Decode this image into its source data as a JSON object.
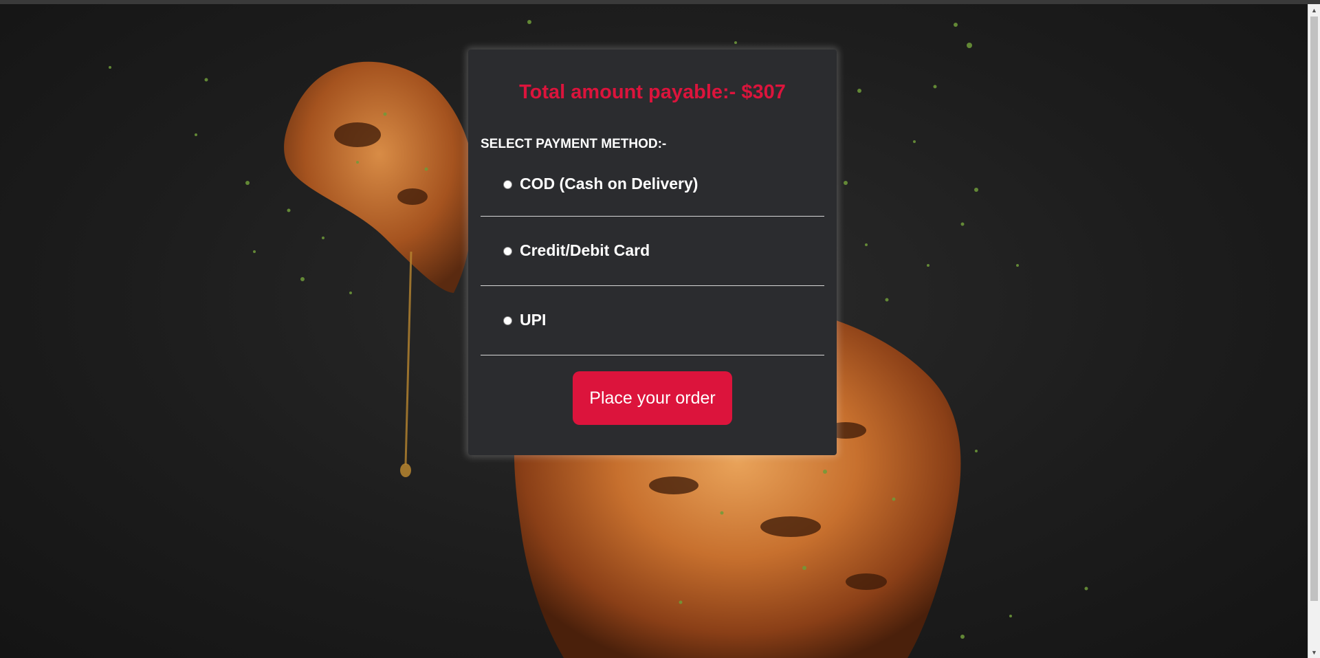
{
  "checkout": {
    "total_label": "Total amount payable:- $307",
    "payment_heading": "SELECT PAYMENT METHOD:-",
    "payment_options": [
      {
        "label": "COD (Cash on Delivery)",
        "selected": false
      },
      {
        "label": "Credit/Debit Card",
        "selected": false
      },
      {
        "label": "UPI",
        "selected": false
      }
    ],
    "place_order_label": "Place your order"
  },
  "colors": {
    "accent": "#dc143c",
    "card_background": "#2b2c2f",
    "page_background": "#1d1d1d",
    "text": "#ffffff"
  },
  "background": {
    "image_subject": "grilled chicken leg with herbs on dark background"
  }
}
